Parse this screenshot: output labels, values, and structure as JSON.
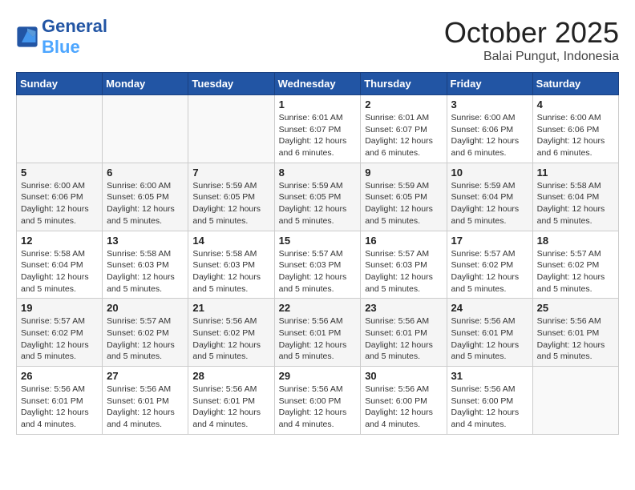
{
  "logo": {
    "line1": "General",
    "line2": "Blue"
  },
  "title": "October 2025",
  "subtitle": "Balai Pungut, Indonesia",
  "weekdays": [
    "Sunday",
    "Monday",
    "Tuesday",
    "Wednesday",
    "Thursday",
    "Friday",
    "Saturday"
  ],
  "weeks": [
    [
      {
        "day": "",
        "info": ""
      },
      {
        "day": "",
        "info": ""
      },
      {
        "day": "",
        "info": ""
      },
      {
        "day": "1",
        "info": "Sunrise: 6:01 AM\nSunset: 6:07 PM\nDaylight: 12 hours\nand 6 minutes."
      },
      {
        "day": "2",
        "info": "Sunrise: 6:01 AM\nSunset: 6:07 PM\nDaylight: 12 hours\nand 6 minutes."
      },
      {
        "day": "3",
        "info": "Sunrise: 6:00 AM\nSunset: 6:06 PM\nDaylight: 12 hours\nand 6 minutes."
      },
      {
        "day": "4",
        "info": "Sunrise: 6:00 AM\nSunset: 6:06 PM\nDaylight: 12 hours\nand 6 minutes."
      }
    ],
    [
      {
        "day": "5",
        "info": "Sunrise: 6:00 AM\nSunset: 6:06 PM\nDaylight: 12 hours\nand 5 minutes."
      },
      {
        "day": "6",
        "info": "Sunrise: 6:00 AM\nSunset: 6:05 PM\nDaylight: 12 hours\nand 5 minutes."
      },
      {
        "day": "7",
        "info": "Sunrise: 5:59 AM\nSunset: 6:05 PM\nDaylight: 12 hours\nand 5 minutes."
      },
      {
        "day": "8",
        "info": "Sunrise: 5:59 AM\nSunset: 6:05 PM\nDaylight: 12 hours\nand 5 minutes."
      },
      {
        "day": "9",
        "info": "Sunrise: 5:59 AM\nSunset: 6:05 PM\nDaylight: 12 hours\nand 5 minutes."
      },
      {
        "day": "10",
        "info": "Sunrise: 5:59 AM\nSunset: 6:04 PM\nDaylight: 12 hours\nand 5 minutes."
      },
      {
        "day": "11",
        "info": "Sunrise: 5:58 AM\nSunset: 6:04 PM\nDaylight: 12 hours\nand 5 minutes."
      }
    ],
    [
      {
        "day": "12",
        "info": "Sunrise: 5:58 AM\nSunset: 6:04 PM\nDaylight: 12 hours\nand 5 minutes."
      },
      {
        "day": "13",
        "info": "Sunrise: 5:58 AM\nSunset: 6:03 PM\nDaylight: 12 hours\nand 5 minutes."
      },
      {
        "day": "14",
        "info": "Sunrise: 5:58 AM\nSunset: 6:03 PM\nDaylight: 12 hours\nand 5 minutes."
      },
      {
        "day": "15",
        "info": "Sunrise: 5:57 AM\nSunset: 6:03 PM\nDaylight: 12 hours\nand 5 minutes."
      },
      {
        "day": "16",
        "info": "Sunrise: 5:57 AM\nSunset: 6:03 PM\nDaylight: 12 hours\nand 5 minutes."
      },
      {
        "day": "17",
        "info": "Sunrise: 5:57 AM\nSunset: 6:02 PM\nDaylight: 12 hours\nand 5 minutes."
      },
      {
        "day": "18",
        "info": "Sunrise: 5:57 AM\nSunset: 6:02 PM\nDaylight: 12 hours\nand 5 minutes."
      }
    ],
    [
      {
        "day": "19",
        "info": "Sunrise: 5:57 AM\nSunset: 6:02 PM\nDaylight: 12 hours\nand 5 minutes."
      },
      {
        "day": "20",
        "info": "Sunrise: 5:57 AM\nSunset: 6:02 PM\nDaylight: 12 hours\nand 5 minutes."
      },
      {
        "day": "21",
        "info": "Sunrise: 5:56 AM\nSunset: 6:02 PM\nDaylight: 12 hours\nand 5 minutes."
      },
      {
        "day": "22",
        "info": "Sunrise: 5:56 AM\nSunset: 6:01 PM\nDaylight: 12 hours\nand 5 minutes."
      },
      {
        "day": "23",
        "info": "Sunrise: 5:56 AM\nSunset: 6:01 PM\nDaylight: 12 hours\nand 5 minutes."
      },
      {
        "day": "24",
        "info": "Sunrise: 5:56 AM\nSunset: 6:01 PM\nDaylight: 12 hours\nand 5 minutes."
      },
      {
        "day": "25",
        "info": "Sunrise: 5:56 AM\nSunset: 6:01 PM\nDaylight: 12 hours\nand 5 minutes."
      }
    ],
    [
      {
        "day": "26",
        "info": "Sunrise: 5:56 AM\nSunset: 6:01 PM\nDaylight: 12 hours\nand 4 minutes."
      },
      {
        "day": "27",
        "info": "Sunrise: 5:56 AM\nSunset: 6:01 PM\nDaylight: 12 hours\nand 4 minutes."
      },
      {
        "day": "28",
        "info": "Sunrise: 5:56 AM\nSunset: 6:01 PM\nDaylight: 12 hours\nand 4 minutes."
      },
      {
        "day": "29",
        "info": "Sunrise: 5:56 AM\nSunset: 6:00 PM\nDaylight: 12 hours\nand 4 minutes."
      },
      {
        "day": "30",
        "info": "Sunrise: 5:56 AM\nSunset: 6:00 PM\nDaylight: 12 hours\nand 4 minutes."
      },
      {
        "day": "31",
        "info": "Sunrise: 5:56 AM\nSunset: 6:00 PM\nDaylight: 12 hours\nand 4 minutes."
      },
      {
        "day": "",
        "info": ""
      }
    ]
  ]
}
